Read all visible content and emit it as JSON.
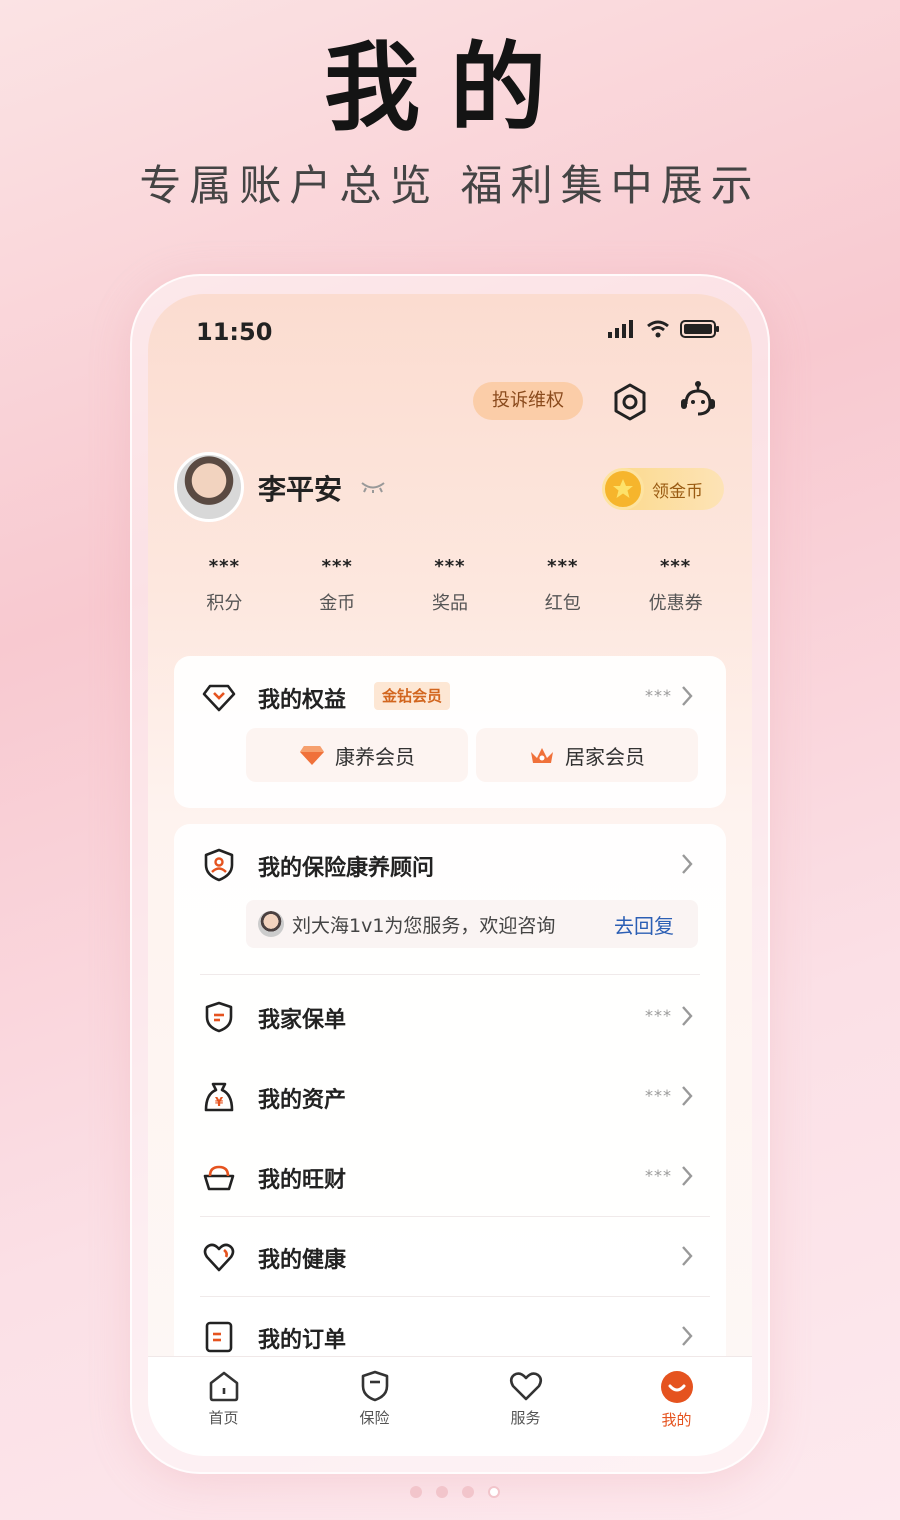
{
  "hero": {
    "title": "我的",
    "subtitle": "专属账户总览  福利集中展示"
  },
  "status_bar": {
    "time": "11:50"
  },
  "header": {
    "complaint_label": "投诉维权",
    "settings_icon": "settings-icon",
    "service_icon": "customer-service-icon"
  },
  "profile": {
    "name": "李平安",
    "coin_button_label": "领金币"
  },
  "stats": [
    {
      "value": "***",
      "label": "积分"
    },
    {
      "value": "***",
      "label": "金币"
    },
    {
      "value": "***",
      "label": "奖品"
    },
    {
      "value": "***",
      "label": "红包"
    },
    {
      "value": "***",
      "label": "优惠券"
    }
  ],
  "rights": {
    "title": "我的权益",
    "badge": "金钻会员",
    "stars": "***",
    "members": [
      "康养会员",
      "居家会员"
    ]
  },
  "advisor": {
    "title": "我的保险康养顾问",
    "message": "刘大海1v1为您服务，欢迎咨询",
    "reply_link": "去回复"
  },
  "menu": [
    {
      "title": "我家保单",
      "stars": "***",
      "icon": "shield-icon"
    },
    {
      "title": "我的资产",
      "stars": "***",
      "icon": "money-bag-icon"
    },
    {
      "title": "我的旺财",
      "stars": "***",
      "icon": "wealth-bowl-icon"
    },
    {
      "title": "我的健康",
      "stars": "",
      "icon": "heart-icon"
    },
    {
      "title": "我的订单",
      "stars": "",
      "icon": "order-icon"
    }
  ],
  "tabbar": [
    {
      "label": "首页",
      "icon": "home-icon"
    },
    {
      "label": "保险",
      "icon": "shield-icon"
    },
    {
      "label": "服务",
      "icon": "heart-icon"
    },
    {
      "label": "我的",
      "icon": "profile-smile-icon",
      "active": true
    }
  ],
  "colors": {
    "accent": "#e5531f",
    "link": "#2c5fb4",
    "badge_bg": "#fde7d4",
    "complaint_bg": "#fbcda8"
  }
}
